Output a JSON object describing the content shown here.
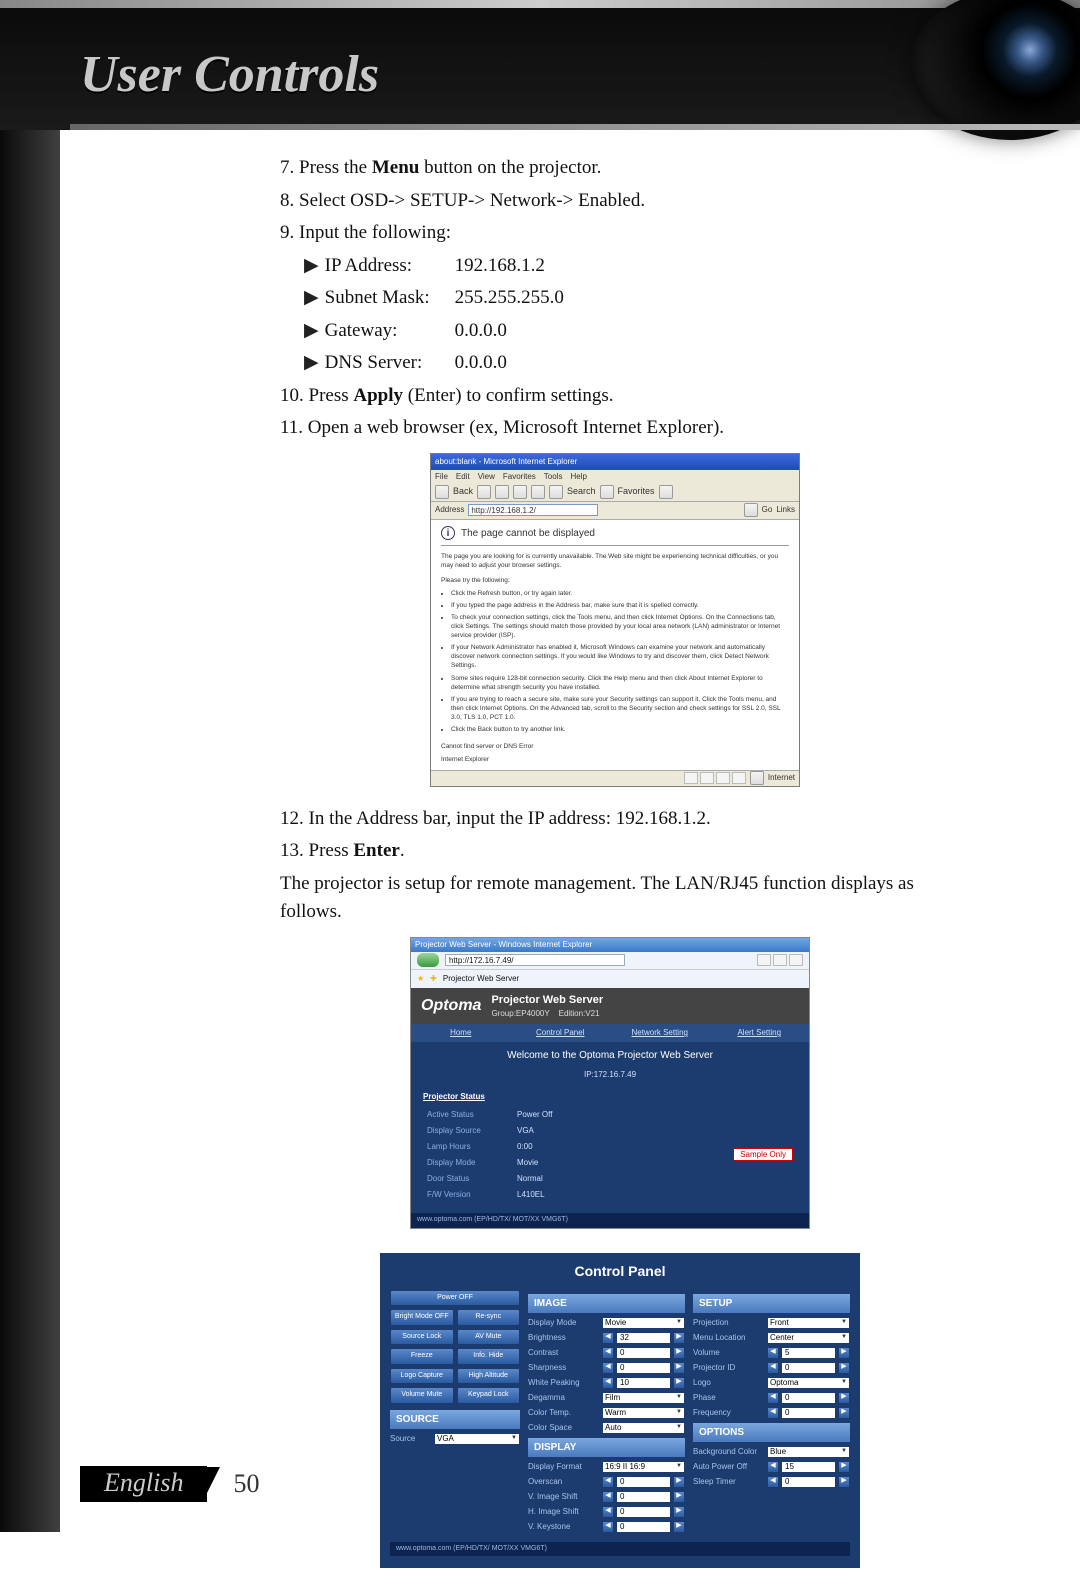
{
  "header": {
    "title": "User Controls"
  },
  "steps": {
    "s7_prefix": "7. Press the ",
    "s7_bold": "Menu",
    "s7_suffix": " button on the projector.",
    "s8": "8. Select OSD-> SETUP-> Network-> Enabled.",
    "s9": "9. Input the following:",
    "net": {
      "ip_label": "IP Address:",
      "ip_val": "192.168.1.2",
      "subnet_label": "Subnet Mask:",
      "subnet_val": "255.255.255.0",
      "gateway_label": "Gateway:",
      "gateway_val": "0.0.0.0",
      "dns_label": "DNS Server:",
      "dns_val": "0.0.0.0"
    },
    "s10_prefix": "10. Press ",
    "s10_bold": "Apply",
    "s10_suffix": " (Enter) to confirm settings.",
    "s11": "11. Open a web browser (ex, Microsoft Internet Explorer).",
    "s12": "12. In the Address bar, input the IP address: 192.168.1.2.",
    "s13_prefix": "13. Press ",
    "s13_bold": "Enter",
    "s13_suffix": ".",
    "final": "The projector is setup for remote management. The LAN/RJ45 function displays as follows."
  },
  "browser1": {
    "title": "about:blank - Microsoft Internet Explorer",
    "menu": [
      "File",
      "Edit",
      "View",
      "Favorites",
      "Tools",
      "Help"
    ],
    "toolbar": [
      "Back",
      "",
      "",
      "",
      "",
      "Search",
      "Favorites",
      ""
    ],
    "address_label": "Address",
    "address_value": "http://192.168.1.2/",
    "go": "Go",
    "links": "Links",
    "cannot": "The page cannot be displayed",
    "para1": "The page you are looking for is currently unavailable. The Web site might be experiencing technical difficulties, or you may need to adjust your browser settings.",
    "try": "Please try the following:",
    "bullets": [
      "Click the Refresh button, or try again later.",
      "If you typed the page address in the Address bar, make sure that it is spelled correctly.",
      "To check your connection settings, click the Tools menu, and then click Internet Options. On the Connections tab, click Settings. The settings should match those provided by your local area network (LAN) administrator or Internet service provider (ISP).",
      "If your Network Administrator has enabled it, Microsoft Windows can examine your network and automatically discover network connection settings. If you would like Windows to try and discover them, click Detect Network Settings.",
      "Some sites require 128-bit connection security. Click the Help menu and then click About Internet Explorer to determine what strength security you have installed.",
      "If you are trying to reach a secure site, make sure your Security settings can support it. Click the Tools menu, and then click Internet Options. On the Advanced tab, scroll to the Security section and check settings for SSL 2.0, SSL 3.0, TLS 1.0, PCT 1.0.",
      "Click the Back button to try another link."
    ],
    "cannot_find": "Cannot find server or DNS Error",
    "ie": "Internet Explorer",
    "status": "Internet"
  },
  "browser2": {
    "title": "Projector Web Server - Windows Internet Explorer",
    "address": "http://172.16.7.49/",
    "tab": "Projector Web Server",
    "logo": "Optoma",
    "head_title": "Projector Web Server",
    "head_sub_left": "Group:EP4000Y",
    "head_sub_right": "Edition:V21",
    "nav": [
      "Home",
      "Control Panel",
      "Network Setting",
      "Alert Setting"
    ],
    "welcome": "Welcome to the Optoma Projector Web Server",
    "ip": "IP:172.16.7.49",
    "status_title": "Projector Status",
    "rows": [
      [
        "Active Status",
        "Power Off"
      ],
      [
        "Display Source",
        "VGA"
      ],
      [
        "Lamp Hours",
        "0:00"
      ],
      [
        "Display Mode",
        "Movie"
      ],
      [
        "Door Status",
        "Normal"
      ],
      [
        "F/W Version",
        "L410EL"
      ]
    ],
    "sample": "Sample Only",
    "footer": "www.optoma.com (EP/HD/TX/ MOT/XX VMG6T)"
  },
  "cp": {
    "title": "Control Panel",
    "left_buttons": [
      "Power OFF",
      "Bright Mode OFF",
      "Re-sync",
      "Source Lock",
      "AV Mute",
      "Freeze",
      "Info. Hide",
      "Logo Capture",
      "High Altitude",
      "Volume Mute",
      "Keypad Lock"
    ],
    "source_head": "SOURCE",
    "source_label": "Source",
    "source_val": "VGA",
    "image_head": "IMAGE",
    "image": [
      {
        "label": "Display Mode",
        "type": "sel",
        "val": "Movie"
      },
      {
        "label": "Brightness",
        "type": "spin",
        "val": "32"
      },
      {
        "label": "Contrast",
        "type": "spin",
        "val": "0"
      },
      {
        "label": "Sharpness",
        "type": "spin",
        "val": "0"
      },
      {
        "label": "White Peaking",
        "type": "spin",
        "val": "10"
      },
      {
        "label": "Degamma",
        "type": "sel",
        "val": "Film"
      },
      {
        "label": "Color Temp.",
        "type": "sel",
        "val": "Warm"
      },
      {
        "label": "Color Space",
        "type": "sel",
        "val": "Auto"
      }
    ],
    "display_head": "DISPLAY",
    "display": [
      {
        "label": "Display Format",
        "type": "sel",
        "val": "16:9 II 16:9"
      },
      {
        "label": "Overscan",
        "type": "spin",
        "val": "0"
      },
      {
        "label": "V. Image Shift",
        "type": "spin",
        "val": "0"
      },
      {
        "label": "H. Image Shift",
        "type": "spin",
        "val": "0"
      },
      {
        "label": "V. Keystone",
        "type": "spin",
        "val": "0"
      }
    ],
    "setup_head": "SETUP",
    "setup": [
      {
        "label": "Projection",
        "type": "sel",
        "val": "Front"
      },
      {
        "label": "Menu Location",
        "type": "sel",
        "val": "Center"
      },
      {
        "label": "Volume",
        "type": "spin",
        "val": "5"
      },
      {
        "label": "Projector ID",
        "type": "spin",
        "val": "0"
      },
      {
        "label": "Logo",
        "type": "sel",
        "val": "Optoma"
      },
      {
        "label": "Phase",
        "type": "spin",
        "val": "0"
      },
      {
        "label": "Frequency",
        "type": "spin",
        "val": "0"
      }
    ],
    "options_head": "OPTIONS",
    "options": [
      {
        "label": "Background Color",
        "type": "sel",
        "val": "Blue"
      },
      {
        "label": "Auto Power Off",
        "type": "spin",
        "val": "15"
      },
      {
        "label": "Sleep Timer",
        "type": "spin",
        "val": "0"
      }
    ],
    "footer": "www.optoma.com (EP/HD/TX/ MOT/XX VMG6T)"
  },
  "footer": {
    "lang": "English",
    "page": "50"
  }
}
